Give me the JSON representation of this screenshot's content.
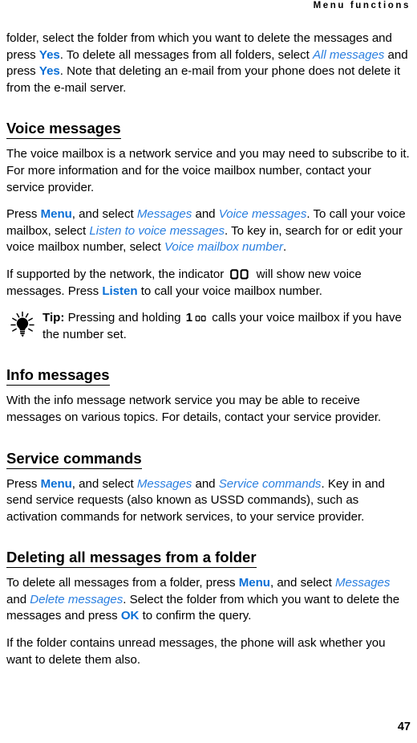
{
  "document": {
    "running_header": "Menu functions",
    "page_number": "47",
    "accent_blue": "#0a6fd6",
    "italic_blue": "#2a7fe0"
  },
  "body": {
    "intro_paragraph": {
      "t1": "folder, select the folder from which you want to delete the messages and press ",
      "kw1": "Yes",
      "t2": ". To delete all messages from all folders, select ",
      "mi1": "All messages",
      "t3": " and press ",
      "kw2": "Yes",
      "t4": ". Note that deleting an e-mail from your phone does not delete it from the e-mail server."
    },
    "sections": {
      "voice_messages": {
        "heading": "Voice messages",
        "p1": "The voice mailbox is a network service and you may need to subscribe to it. For more information and for the voice mailbox number, contact your service provider.",
        "p2": {
          "t1": "Press ",
          "kw1": "Menu",
          "t2": ", and select ",
          "mi1": "Messages",
          "t3": " and ",
          "mi2": "Voice messages",
          "t4": ". To call your voice mailbox, select ",
          "mi3": "Listen to voice messages",
          "t5": ". To key in, search for or edit your voice mailbox number, select ",
          "mi4": "Voice mailbox number",
          "t6": "."
        },
        "p3": {
          "t1": "If supported by the network, the indicator ",
          "icon": "voicemail-indicator-icon",
          "t2": " will show new voice messages. Press ",
          "kw1": "Listen",
          "t3": " to call your voice mailbox number."
        },
        "tip": {
          "icon": "lightbulb-tip-icon",
          "label": "Tip:",
          "t1": " Pressing and holding ",
          "key": "1",
          "key_icon": "voicemail-key-icon",
          "t2": " calls your voice mailbox if you have the number set."
        }
      },
      "info_messages": {
        "heading": "Info messages",
        "p1": "With the info message network service you may be able to receive messages on various topics. For details, contact your service provider."
      },
      "service_commands": {
        "heading": "Service commands",
        "p1": {
          "t1": "Press ",
          "kw1": "Menu",
          "t2": ", and select ",
          "mi1": "Messages",
          "t3": " and ",
          "mi2": "Service commands",
          "t4": ". Key in and send service requests (also known as USSD commands), such as activation commands for network services, to your service provider."
        }
      },
      "deleting_all_messages": {
        "heading": "Deleting all messages from a folder",
        "p1": {
          "t1": "To delete all messages from a folder, press ",
          "kw1": "Menu",
          "t2": ", and select ",
          "mi1": "Messages",
          "t3": " and ",
          "mi2": "Delete messages",
          "t4": ". Select the folder from which you want to delete the messages and press ",
          "kw2": "OK",
          "t5": " to confirm the query."
        },
        "p2": "If the folder contains unread messages, the phone will ask whether you want to delete them also."
      }
    }
  }
}
